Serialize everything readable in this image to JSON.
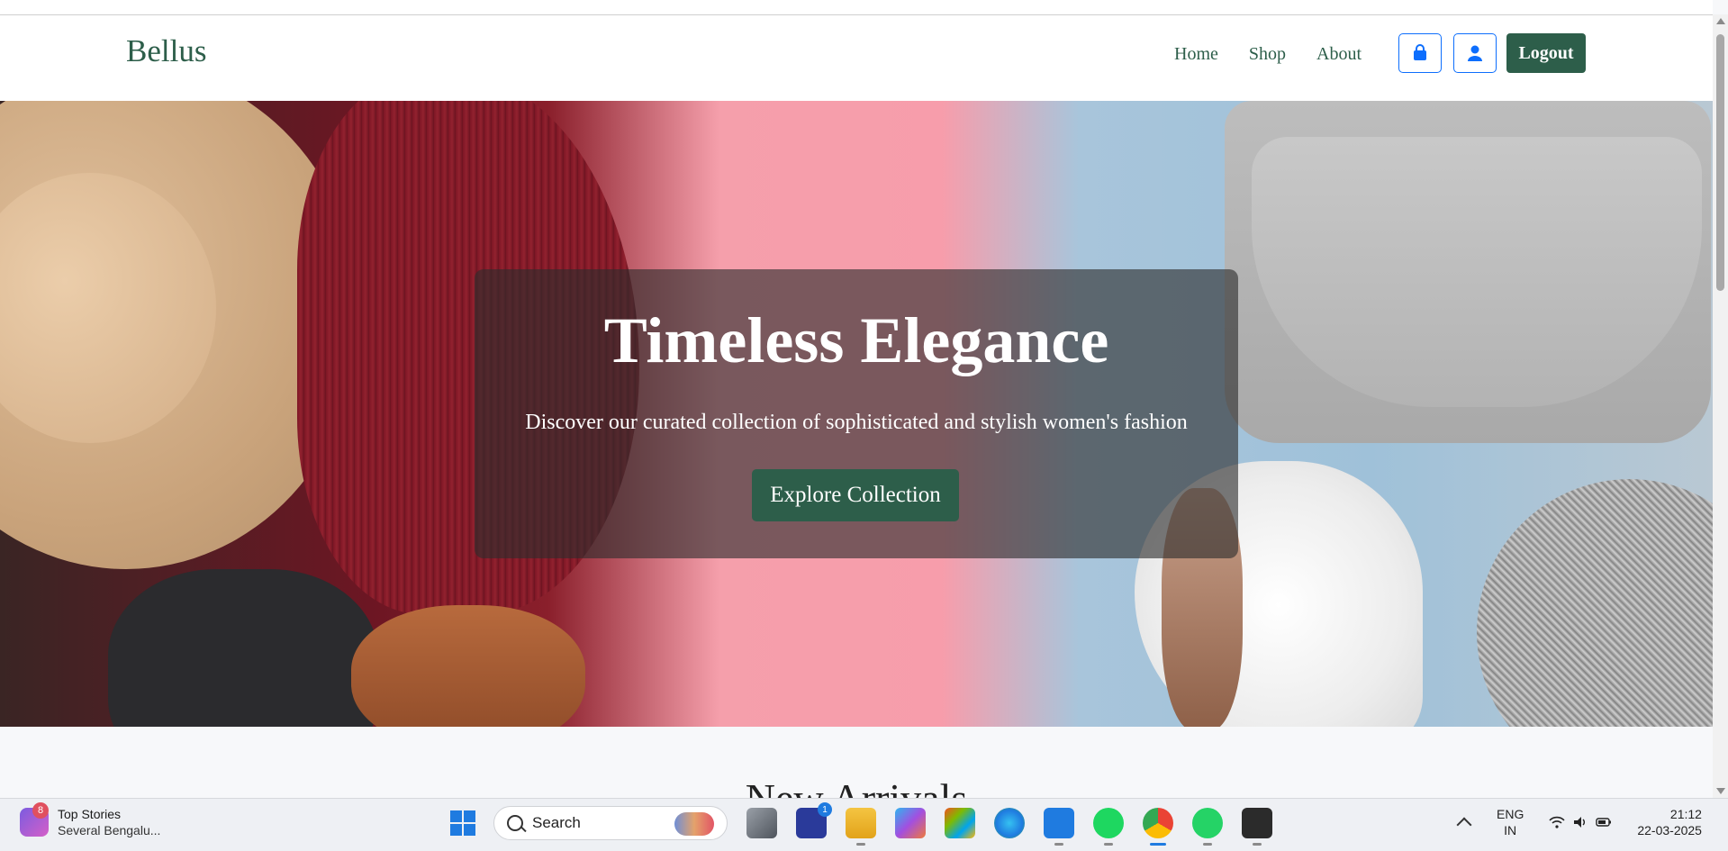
{
  "navbar": {
    "brand": "Bellus",
    "links": [
      "Home",
      "Shop",
      "About"
    ],
    "logout_label": "Logout",
    "accent_color": "#2d5e4a",
    "icon_button_color": "#0d6efd"
  },
  "hero": {
    "title": "Timeless Elegance",
    "subtitle": "Discover our curated collection of sophisticated and stylish women's fashion",
    "cta_label": "Explore Collection"
  },
  "section": {
    "heading": "New Arrivals"
  },
  "taskbar": {
    "news_title": "Top Stories",
    "news_subtitle": "Several Bengalu...",
    "news_badge": "8",
    "search_label": "Search",
    "app_badge": "1",
    "lang_primary": "ENG",
    "lang_secondary": "IN",
    "time": "21:12",
    "date": "22-03-2025"
  }
}
